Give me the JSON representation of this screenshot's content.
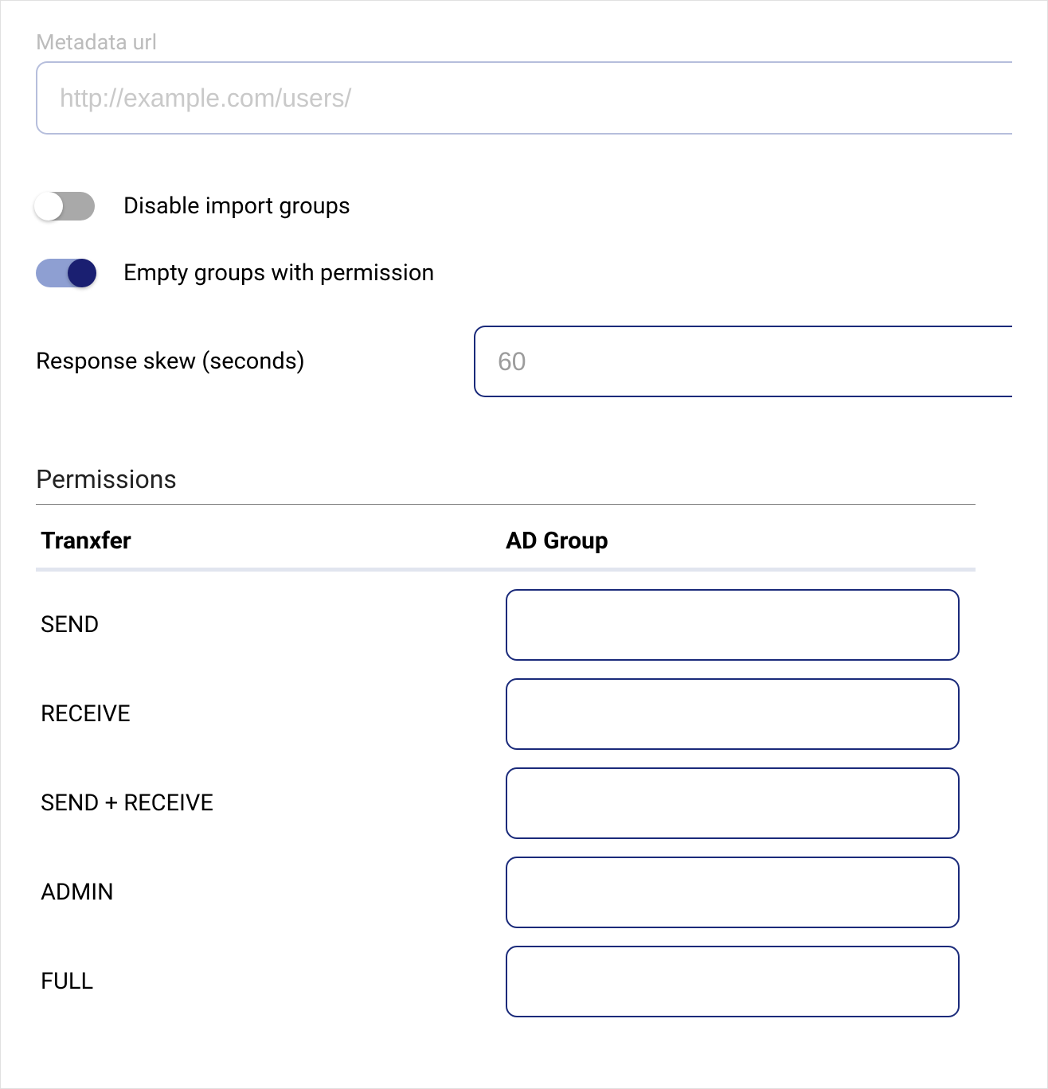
{
  "metadata": {
    "label": "Metadata url",
    "placeholder": "http://example.com/users/",
    "value": ""
  },
  "toggles": {
    "disable_import_groups": {
      "label": "Disable import groups",
      "on": false
    },
    "empty_groups_permission": {
      "label": "Empty groups with permission",
      "on": true
    }
  },
  "response_skew": {
    "label": "Response skew (seconds)",
    "placeholder": "60",
    "value": ""
  },
  "permissions": {
    "title": "Permissions",
    "columns": {
      "c1": "Tranxfer",
      "c2": "AD Group"
    },
    "rows": [
      {
        "name": "SEND",
        "value": ""
      },
      {
        "name": "RECEIVE",
        "value": ""
      },
      {
        "name": "SEND + RECEIVE",
        "value": ""
      },
      {
        "name": "ADMIN",
        "value": ""
      },
      {
        "name": "FULL",
        "value": ""
      }
    ]
  }
}
